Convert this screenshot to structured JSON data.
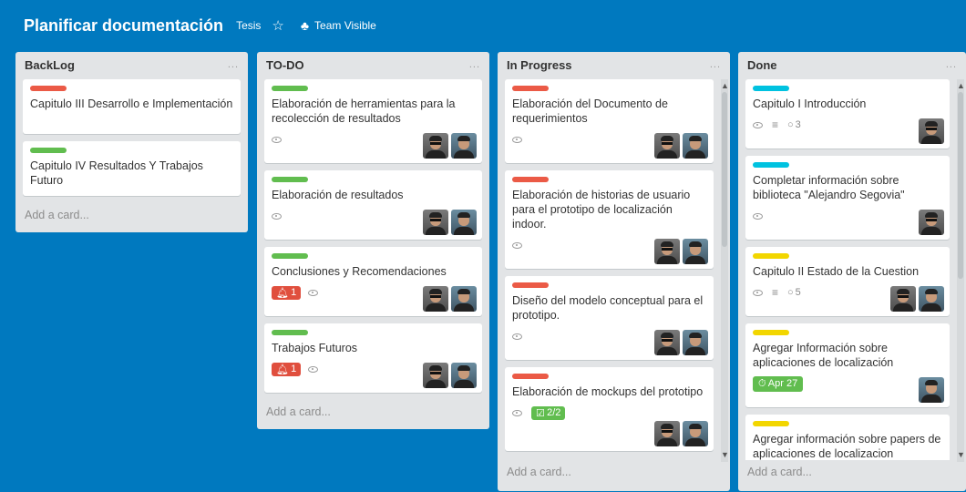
{
  "board": {
    "title": "Planificar documentación",
    "team": "Tesis",
    "visibility": "Team Visible",
    "star_icon": "star-icon",
    "team_icon": "team-icon"
  },
  "colors": {
    "background": "#0079bf",
    "red": "#eb5a46",
    "green": "#61bd4f",
    "blue": "#00c2e0",
    "yellow": "#f2d600"
  },
  "lists": [
    {
      "title": "BackLog",
      "menu": "...",
      "add": "Add a card...",
      "cards": [
        {
          "label": "red",
          "title": "Capitulo III Desarrollo e Implementación"
        },
        {
          "label": "green",
          "title": "Capitulo IV Resultados Y Trabajos Futuro"
        }
      ]
    },
    {
      "title": "TO-DO",
      "menu": "...",
      "add": "Add a card...",
      "cards": [
        {
          "label": "green",
          "title": "Elaboración de herramientas para la recolección de resultados",
          "avatars": 2
        },
        {
          "label": "green",
          "title": "Elaboración de resultados",
          "avatars": 2
        },
        {
          "label": "green",
          "title": "Conclusiones y Recomendaciones",
          "alert": "1",
          "avatars": 2
        },
        {
          "label": "green",
          "title": "Trabajos Futuros",
          "alert": "1",
          "avatars": 2
        }
      ]
    },
    {
      "title": "In Progress",
      "menu": "...",
      "add": "Add a card...",
      "cards": [
        {
          "label": "red",
          "title": "Elaboración del Documento de requerimientos",
          "avatars": 2
        },
        {
          "label": "red",
          "title": "Elaboración de historias de usuario para el prototipo de localización indoor.",
          "avatars": 2
        },
        {
          "label": "red",
          "title": "Diseño del modelo conceptual para el prototipo.",
          "avatars": 2
        },
        {
          "label": "red",
          "title": "Elaboración de mockups del prototipo",
          "checklist": "2/2",
          "avatars": 2
        }
      ]
    },
    {
      "title": "Done",
      "menu": "...",
      "add": "Add a card...",
      "cards": [
        {
          "label": "blue",
          "title": "Capitulo I Introducción",
          "comments": "3",
          "avatars": 1
        },
        {
          "label": "blue",
          "title": "Completar información sobre biblioteca \"Alejandro Segovia\"",
          "avatars": 1
        },
        {
          "label": "yellow",
          "title": "Capitulo II Estado de la Cuestion",
          "comments": "5",
          "avatars": 2
        },
        {
          "label": "yellow",
          "title": "Agregar Información sobre aplicaciones de localización",
          "due": "Apr 27",
          "avatars": 1
        },
        {
          "label": "yellow",
          "title": "Agregar información sobre papers de aplicaciones de localizacion"
        }
      ]
    }
  ]
}
